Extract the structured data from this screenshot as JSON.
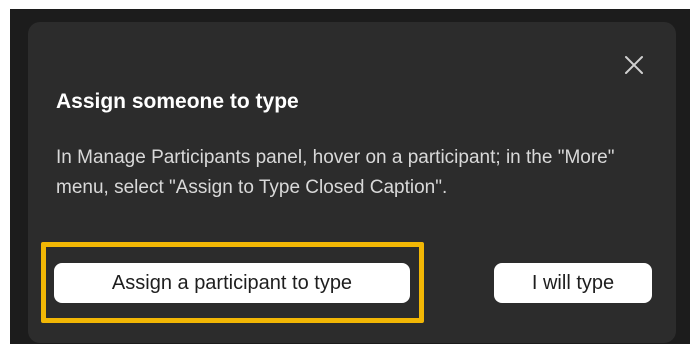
{
  "dialog": {
    "title": "Assign someone to type",
    "description": "In Manage Participants panel, hover on a participant; in the \"More\" menu, select \"Assign to Type Closed Caption\".",
    "close_icon": "close-icon",
    "assign_button_label": "Assign a participant to type",
    "self_button_label": "I will type"
  },
  "colors": {
    "backdrop": "#1c1c1c",
    "dialog_background": "#2c2c2c",
    "highlight": "#f2b705",
    "button_background": "#ffffff"
  }
}
